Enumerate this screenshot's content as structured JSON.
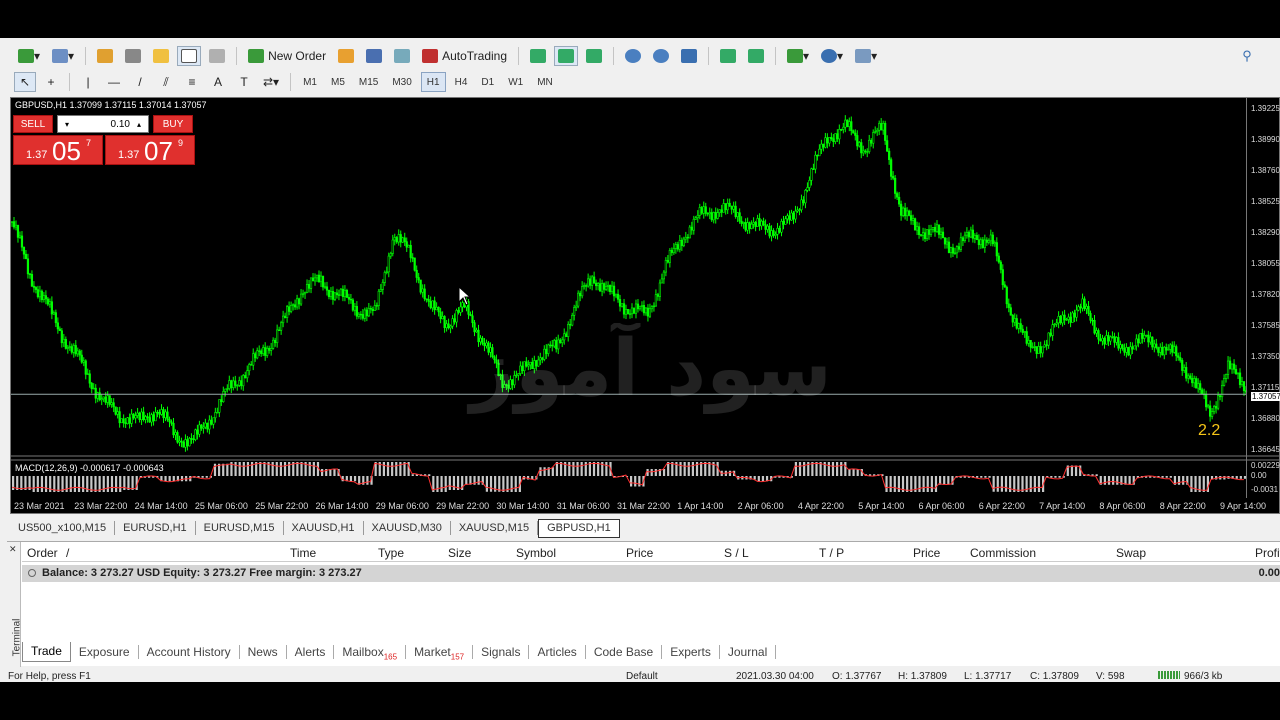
{
  "toolbar": {
    "new_order_label": "New Order",
    "autotrading_label": "AutoTrading",
    "timeframes": [
      "M1",
      "M5",
      "M15",
      "M30",
      "H1",
      "H4",
      "D1",
      "W1",
      "MN"
    ],
    "active_timeframe": "H1"
  },
  "chart": {
    "title": "GBPUSD,H1  1.37099 1.37115 1.37014 1.37057",
    "sell_label": "SELL",
    "buy_label": "BUY",
    "lot": "0.10",
    "sell_price_prefix": "1.37",
    "sell_price_big": "05",
    "sell_price_sup": "7",
    "buy_price_prefix": "1.37",
    "buy_price_big": "07",
    "buy_price_sup": "9",
    "spread": "2.2",
    "macd_label": "MACD(12,26,9) -0.000617 -0.000643",
    "watermark_text": "سود آموز",
    "line_color": "#00ff00",
    "signal_color": "#ff3030"
  },
  "chart_data": {
    "type": "line",
    "title": "GBPUSD,H1",
    "y_ticks": [
      "1.39225",
      "1.38990",
      "1.38760",
      "1.38525",
      "1.38290",
      "1.38055",
      "1.37820",
      "1.37585",
      "1.37350",
      "1.37115",
      "1.37057",
      "1.36880",
      "1.36645"
    ],
    "current_price": "1.37057",
    "macd_ticks": [
      "0.00229",
      "0.00",
      "-0.0031"
    ],
    "x_ticks": [
      "23 Mar 2021",
      "23 Mar 22:00",
      "24 Mar 14:00",
      "25 Mar 06:00",
      "25 Mar 22:00",
      "26 Mar 14:00",
      "29 Mar 06:00",
      "29 Mar 22:00",
      "30 Mar 14:00",
      "31 Mar 06:00",
      "31 Mar 22:00",
      "1 Apr 14:00",
      "2 Apr 06:00",
      "4 Apr 22:00",
      "5 Apr 14:00",
      "6 Apr 06:00",
      "6 Apr 22:00",
      "7 Apr 14:00",
      "8 Apr 06:00",
      "8 Apr 22:00",
      "9 Apr 14:00"
    ],
    "close": [
      1.3835,
      1.3795,
      1.377,
      1.3745,
      1.3725,
      1.37,
      1.369,
      1.3685,
      1.3695,
      1.3675,
      1.367,
      1.369,
      1.371,
      1.3725,
      1.374,
      1.376,
      1.3785,
      1.379,
      1.378,
      1.377,
      1.3765,
      1.3825,
      1.381,
      1.377,
      1.376,
      1.377,
      1.3745,
      1.3715,
      1.372,
      1.3735,
      1.374,
      1.377,
      1.3795,
      1.378,
      1.377,
      1.3765,
      1.38,
      1.3825,
      1.384,
      1.3845,
      1.384,
      1.383,
      1.383,
      1.3835,
      1.387,
      1.39,
      1.3905,
      1.389,
      1.3905,
      1.384,
      1.383,
      1.3825,
      1.3815,
      1.3825,
      1.382,
      1.377,
      1.374,
      1.3745,
      1.3765,
      1.377,
      1.375,
      1.374,
      1.3745,
      1.3745,
      1.3735,
      1.372,
      1.369,
      1.3725,
      1.3712
    ]
  },
  "chart_tabs": [
    "US500_x100,M15",
    "EURUSD,H1",
    "EURUSD,M15",
    "XAUUSD,H1",
    "XAUUSD,M30",
    "XAUUSD,M15",
    "GBPUSD,H1"
  ],
  "active_chart_tab": "GBPUSD,H1",
  "terminal": {
    "side_label": "Terminal",
    "close_glyph": "✕",
    "columns": [
      "Order",
      "/",
      "Time",
      "Type",
      "Size",
      "Symbol",
      "Price",
      "S / L",
      "T / P",
      "Price",
      "Commission",
      "Swap",
      "Profit"
    ],
    "balance_text": "Balance: 3 273.27 USD  Equity: 3 273.27  Free margin: 3 273.27",
    "profit_value": "0.00",
    "tabs": [
      {
        "label": "Trade",
        "badge": ""
      },
      {
        "label": "Exposure",
        "badge": ""
      },
      {
        "label": "Account History",
        "badge": ""
      },
      {
        "label": "News",
        "badge": ""
      },
      {
        "label": "Alerts",
        "badge": ""
      },
      {
        "label": "Mailbox",
        "badge": "165"
      },
      {
        "label": "Market",
        "badge": "157"
      },
      {
        "label": "Signals",
        "badge": ""
      },
      {
        "label": "Articles",
        "badge": ""
      },
      {
        "label": "Code Base",
        "badge": ""
      },
      {
        "label": "Experts",
        "badge": ""
      },
      {
        "label": "Journal",
        "badge": ""
      }
    ]
  },
  "statusbar": {
    "help": "For Help, press F1",
    "profile": "Default",
    "datetime": "2021.03.30 04:00",
    "open": "O: 1.37767",
    "high": "H: 1.37809",
    "low": "L: 1.37717",
    "close": "C: 1.37809",
    "volume": "V: 598",
    "traffic": "966/3 kb"
  }
}
